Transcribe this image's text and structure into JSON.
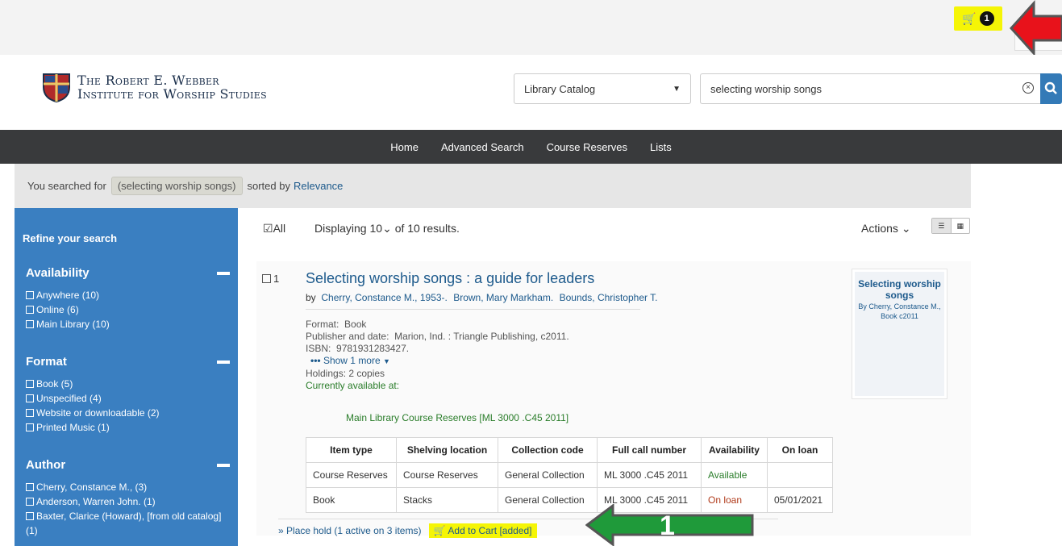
{
  "topbar": {
    "cart_count": "1"
  },
  "header": {
    "logo_line1": "The Robert E. Webber",
    "logo_line2": "Institute for Worship Studies",
    "search_type": "Library Catalog",
    "search_query": "selecting worship songs"
  },
  "nav": {
    "items": [
      "Home",
      "Advanced Search",
      "Course Reserves",
      "Lists"
    ]
  },
  "crumbs": {
    "prefix": "You searched for",
    "term": "(selecting worship songs)",
    "sorted_by": "sorted by",
    "sort": "Relevance"
  },
  "sidebar": {
    "refine": "Refine your search",
    "facets": [
      {
        "title": "Availability",
        "items": [
          "Anywhere  (10)",
          "Online  (6)",
          "Main Library  (10)"
        ]
      },
      {
        "title": "Format",
        "items": [
          "Book  (5)",
          "Unspecified  (4)",
          "Website or downloadable  (2)",
          "Printed Music  (1)"
        ]
      },
      {
        "title": "Author",
        "items": [
          "Cherry, Constance M.,  (3)",
          "Anderson, Warren John.  (1)",
          "Baxter, Clarice (Howard), [from old catalog]",
          "(1)"
        ]
      }
    ]
  },
  "results": {
    "select_all": "All",
    "displaying": "Displaying 10",
    "of_total": "of 10 results.",
    "actions": "Actions"
  },
  "result": {
    "number": "1",
    "title": "Selecting worship songs : a guide for leaders",
    "by": "by",
    "authors": [
      "Cherry, Constance M., 1953-.",
      "Brown, Mary Markham.",
      "Bounds, Christopher T."
    ],
    "format_label": "Format:",
    "format": "Book",
    "publisher_label": "Publisher and date:",
    "publisher": "Marion, Ind. : Triangle Publishing, c2011.",
    "isbn_label": "ISBN:",
    "isbn": "9781931283427.",
    "show_more": "Show 1 more",
    "holdings": "Holdings: 2 copies",
    "available_at": "Currently available at:",
    "location": "Main Library Course Reserves [ML 3000 .C45 2011]",
    "table": {
      "headers": [
        "Item type",
        "Shelving location",
        "Collection code",
        "Full call number",
        "Availability",
        "On loan"
      ],
      "rows": [
        [
          "Course Reserves",
          "Course Reserves",
          "General Collection",
          "ML 3000 .C45 2011",
          "Available",
          ""
        ],
        [
          "Book",
          "Stacks",
          "General Collection",
          "ML 3000 .C45 2011",
          "On loan",
          "05/01/2021"
        ]
      ]
    },
    "place_hold": "Place hold (1 active on 3 items)",
    "add_to_cart": "Add to Cart [added]",
    "cover": {
      "title": "Selecting worship songs",
      "by": "By Cherry, Constance M.,",
      "type": "Book c2011"
    }
  },
  "annotation": {
    "step_label": "1"
  },
  "colors": {
    "accent": "#337ab7",
    "sidebar": "#3a7fc1",
    "nav": "#393a3c",
    "highlight": "#f5f506",
    "arrow_red": "#e8121b",
    "arrow_green": "#1f9a3a"
  }
}
